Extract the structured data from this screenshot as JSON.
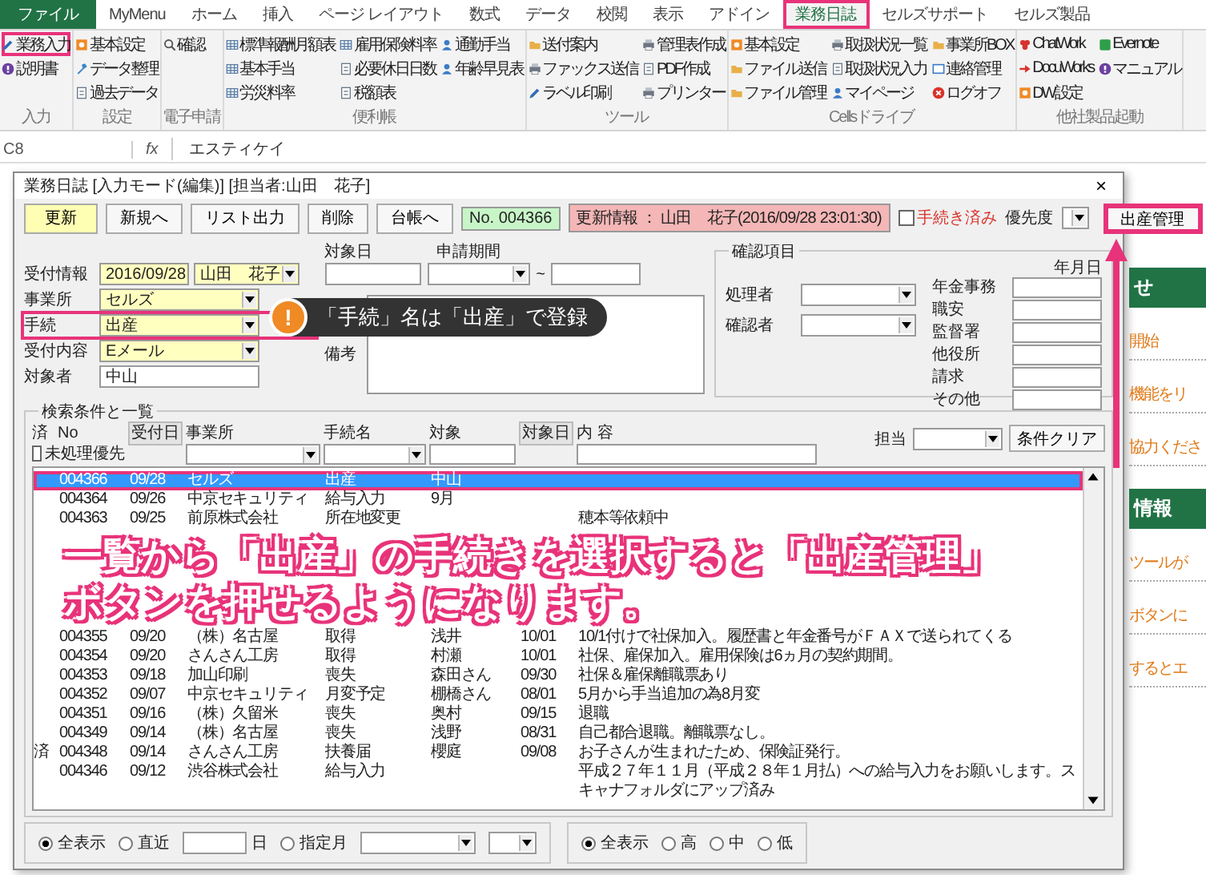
{
  "ribbon": {
    "tabs": [
      {
        "label": "ファイル",
        "kind": "file",
        "selected": false,
        "highlighted": false
      },
      {
        "label": "MyMenu",
        "kind": "tab",
        "selected": false,
        "highlighted": false
      },
      {
        "label": "ホーム",
        "kind": "tab",
        "selected": false,
        "highlighted": false
      },
      {
        "label": "挿入",
        "kind": "tab",
        "selected": false,
        "highlighted": false
      },
      {
        "label": "ページ レイアウト",
        "kind": "tab",
        "selected": false,
        "highlighted": false
      },
      {
        "label": "数式",
        "kind": "tab",
        "selected": false,
        "highlighted": false
      },
      {
        "label": "データ",
        "kind": "tab",
        "selected": false,
        "highlighted": false
      },
      {
        "label": "校閲",
        "kind": "tab",
        "selected": false,
        "highlighted": false
      },
      {
        "label": "表示",
        "kind": "tab",
        "selected": false,
        "highlighted": false
      },
      {
        "label": "アドイン",
        "kind": "tab",
        "selected": false,
        "highlighted": false
      },
      {
        "label": "業務日誌",
        "kind": "tab",
        "selected": true,
        "highlighted": true
      },
      {
        "label": "セルズサポート",
        "kind": "tab",
        "selected": false,
        "highlighted": false
      },
      {
        "label": "セルズ製品",
        "kind": "tab",
        "selected": false,
        "highlighted": false
      }
    ],
    "groups": [
      {
        "label": "入力",
        "items": [
          {
            "label": "業務入力",
            "highlighted": true
          },
          {
            "label": "説明書",
            "highlighted": false
          }
        ]
      },
      {
        "label": "設定",
        "items": [
          {
            "label": "基本設定",
            "highlighted": false
          },
          {
            "label": "データ整理",
            "highlighted": false
          },
          {
            "label": "過去データ",
            "highlighted": false
          }
        ]
      },
      {
        "label": "電子申請",
        "items": [
          {
            "label": "確認",
            "highlighted": false
          }
        ]
      },
      {
        "label": "便利帳",
        "items": [
          {
            "label": "標準報酬月額表",
            "highlighted": false
          },
          {
            "label": "基本手当",
            "highlighted": false
          },
          {
            "label": "労災料率",
            "highlighted": false
          },
          {
            "label": "雇用保険料率",
            "highlighted": false
          },
          {
            "label": "必要休日日数",
            "highlighted": false
          },
          {
            "label": "税額表",
            "highlighted": false
          },
          {
            "label": "通勤手当",
            "highlighted": false
          },
          {
            "label": "年齢早見表",
            "highlighted": false
          }
        ]
      },
      {
        "label": "ツール",
        "items": [
          {
            "label": "送付案内",
            "highlighted": false
          },
          {
            "label": "ファックス送信",
            "highlighted": false
          },
          {
            "label": "ラベル印刷",
            "highlighted": false
          },
          {
            "label": "管理表作成",
            "highlighted": false
          },
          {
            "label": "PDF作成",
            "highlighted": false
          },
          {
            "label": "プリンター",
            "highlighted": false
          }
        ]
      },
      {
        "label": "Cellsドライブ",
        "items": [
          {
            "label": "基本設定",
            "highlighted": false
          },
          {
            "label": "ファイル送信",
            "highlighted": false
          },
          {
            "label": "ファイル管理",
            "highlighted": false
          },
          {
            "label": "取扱状況一覧",
            "highlighted": false
          },
          {
            "label": "取扱状況入力",
            "highlighted": false
          },
          {
            "label": "マイページ",
            "highlighted": false
          },
          {
            "label": "事業所BOX",
            "highlighted": false
          },
          {
            "label": "連絡管理",
            "highlighted": false
          },
          {
            "label": "ログオフ",
            "highlighted": false
          }
        ]
      },
      {
        "label": "他社製品起動",
        "items": [
          {
            "label": "ChatWork",
            "highlighted": false
          },
          {
            "label": "DocuWorks",
            "highlighted": false
          },
          {
            "label": "DW設定",
            "highlighted": false
          },
          {
            "label": "Evernote",
            "highlighted": false
          },
          {
            "label": "マニュアル",
            "highlighted": false
          }
        ]
      }
    ]
  },
  "formula_bar": {
    "cell": "C8",
    "fx": "fx",
    "value": "エスティケイ"
  },
  "dialog": {
    "title": "業務日誌 [入力モード(編集)] [担当者:山田　花子]",
    "close": "×",
    "toolbar": {
      "buttons": [
        {
          "label": "更新",
          "kind": "primary"
        },
        {
          "label": "新規へ",
          "kind": "normal"
        },
        {
          "label": "リスト出力",
          "kind": "normal"
        },
        {
          "label": "削除",
          "kind": "normal"
        },
        {
          "label": "台帳へ",
          "kind": "normal"
        }
      ],
      "record_no": "No. 004366",
      "update_info": "更新情報 ： 山田　花子(2016/09/28 23:01:30)",
      "done": {
        "label": "手続き済み",
        "checked": false
      },
      "priority_label": "優先度",
      "birth_button": {
        "label": "出産管理",
        "highlighted": true
      }
    },
    "form": {
      "reception": {
        "label": "受付情報",
        "date": "2016/09/28",
        "person": "山田　花子"
      },
      "fields": [
        {
          "label": "事業所",
          "value": "セルズ",
          "highlighted": false
        },
        {
          "label": "手続",
          "value": "出産",
          "highlighted": true
        },
        {
          "label": "受付内容",
          "value": "Eメール",
          "highlighted": false
        }
      ],
      "target_person": {
        "label": "対象者",
        "value": "中山"
      },
      "target_date_label": "対象日",
      "period_label": "申請期間",
      "tilde": "~",
      "notes_label": "備考"
    },
    "check": {
      "title": "確認項目",
      "people": [
        "処理者",
        "確認者"
      ],
      "date_header": "年月日",
      "offices": [
        "年金事務",
        "職安",
        "監督署",
        "他役所",
        "請求",
        "その他"
      ]
    },
    "list": {
      "title": "検索条件と一覧",
      "columns": [
        "済",
        "No",
        "受付日",
        "事業所",
        "手続名",
        "対象",
        "対象日",
        "内 容"
      ],
      "unprocessed": {
        "label": "未処理優先",
        "checked": false
      },
      "assignee_label": "担当",
      "clear_button": "条件クリア",
      "rows_top": [
        {
          "cells": [
            "",
            "004366",
            "09/28",
            "セルズ",
            "出産",
            "中山",
            "",
            ""
          ],
          "selected": true
        },
        {
          "cells": [
            "",
            "004364",
            "09/26",
            "中京セキュリティ",
            "給与入力",
            "9月",
            "",
            ""
          ],
          "selected": false
        },
        {
          "cells": [
            "",
            "004363",
            "09/25",
            "前原株式会社",
            "所在地変更",
            "",
            "",
            "穂本等依頼中"
          ],
          "selected": false
        }
      ],
      "rows_bottom": [
        {
          "cells": [
            "",
            "004355",
            "09/20",
            "（株）名古屋",
            "取得",
            "浅井",
            "10/01",
            "10/1付けで社保加入。履歴書と年金番号がＦＡＸで送られてくる"
          ],
          "selected": false
        },
        {
          "cells": [
            "",
            "004354",
            "09/20",
            "さんさん工房",
            "取得",
            "村瀬",
            "10/01",
            "社保、雇保加入。雇用保険は6ヵ月の契約期間。"
          ],
          "selected": false
        },
        {
          "cells": [
            "",
            "004353",
            "09/18",
            "加山印刷",
            "喪失",
            "森田さん",
            "09/30",
            "社保＆雇保離職票あり"
          ],
          "selected": false
        },
        {
          "cells": [
            "",
            "004352",
            "09/07",
            "中京セキュリティ",
            "月変予定",
            "棚橋さん",
            "08/01",
            "5月から手当追加の為8月変"
          ],
          "selected": false
        },
        {
          "cells": [
            "",
            "004351",
            "09/16",
            "（株）久留米",
            "喪失",
            "奥村",
            "09/15",
            "退職"
          ],
          "selected": false
        },
        {
          "cells": [
            "",
            "004349",
            "09/14",
            "（株）名古屋",
            "喪失",
            "浅野",
            "08/31",
            "自己都合退職。離職票なし。"
          ],
          "selected": false
        },
        {
          "cells": [
            "済",
            "004348",
            "09/14",
            "さんさん工房",
            "扶養届",
            "櫻庭",
            "09/08",
            "お子さんが生まれたため、保険証発行。"
          ],
          "selected": false
        },
        {
          "cells": [
            "",
            "004346",
            "09/12",
            "渋谷株式会社",
            "給与入力",
            "",
            "",
            "平成２７年１１月（平成２８年１月払）への給与入力をお願いします。スキャナフォルダにアップ済み"
          ],
          "selected": false
        }
      ]
    },
    "filters": {
      "period": [
        {
          "label": "全表示",
          "selected": true
        },
        {
          "label": "直近",
          "selected": false
        },
        {
          "label": "指定月",
          "selected": false
        }
      ],
      "days_unit": "日",
      "priority": [
        {
          "label": "全表示",
          "selected": true
        },
        {
          "label": "高",
          "selected": false
        },
        {
          "label": "中",
          "selected": false
        },
        {
          "label": "低",
          "selected": false
        }
      ]
    }
  },
  "sheet_strip": [
    {
      "text": "せ",
      "kind": "banner"
    },
    {
      "text": "開始",
      "kind": "link"
    },
    {
      "text": "機能をリ",
      "kind": "link"
    },
    {
      "text": "協力くださ",
      "kind": "link"
    },
    {
      "text": "情報",
      "kind": "banner"
    },
    {
      "text": "ツールが",
      "kind": "link"
    },
    {
      "text": "ボタンに",
      "kind": "link"
    },
    {
      "text": "するとエ",
      "kind": "link"
    }
  ],
  "callout": {
    "mark": "!",
    "text": "「手続」名は「出産」で登録"
  },
  "annotation": [
    "一覧から「出産」の手続きを選択すると「出産管理」",
    "ボタンを押せるようになります。"
  ]
}
